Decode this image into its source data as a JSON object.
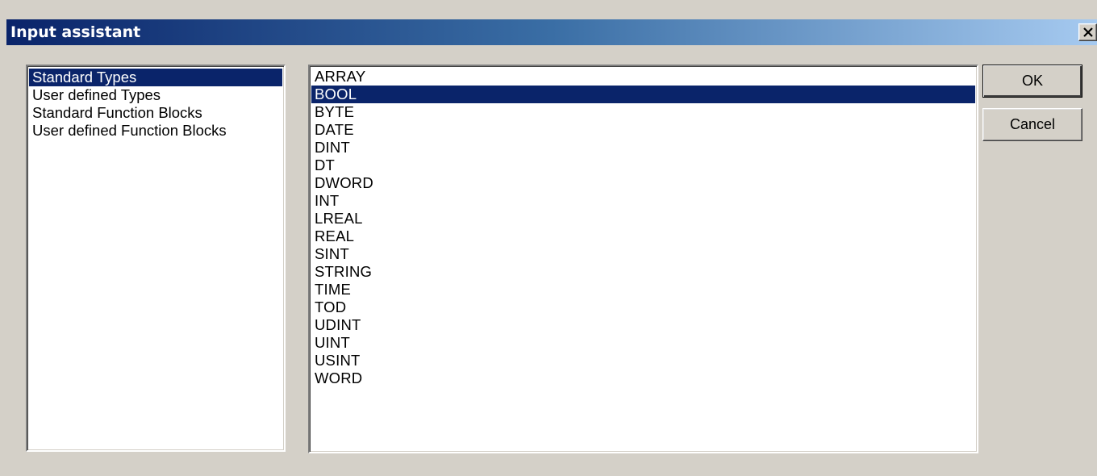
{
  "window": {
    "title": "Input assistant",
    "titlebar_colors": [
      "#0a246a",
      "#3a6ea5",
      "#a6caf0"
    ],
    "close_icon": "close-icon"
  },
  "categories": {
    "items": [
      {
        "label": "Standard Types",
        "selected": true
      },
      {
        "label": "User defined Types",
        "selected": false
      },
      {
        "label": "Standard Function Blocks",
        "selected": false
      },
      {
        "label": "User defined Function Blocks",
        "selected": false
      }
    ]
  },
  "types": {
    "items": [
      {
        "label": "ARRAY",
        "selected": false
      },
      {
        "label": "BOOL",
        "selected": true
      },
      {
        "label": "BYTE",
        "selected": false
      },
      {
        "label": "DATE",
        "selected": false
      },
      {
        "label": "DINT",
        "selected": false
      },
      {
        "label": "DT",
        "selected": false
      },
      {
        "label": "DWORD",
        "selected": false
      },
      {
        "label": "INT",
        "selected": false
      },
      {
        "label": "LREAL",
        "selected": false
      },
      {
        "label": "REAL",
        "selected": false
      },
      {
        "label": "SINT",
        "selected": false
      },
      {
        "label": "STRING",
        "selected": false
      },
      {
        "label": "TIME",
        "selected": false
      },
      {
        "label": "TOD",
        "selected": false
      },
      {
        "label": "UDINT",
        "selected": false
      },
      {
        "label": "UINT",
        "selected": false
      },
      {
        "label": "USINT",
        "selected": false
      },
      {
        "label": "WORD",
        "selected": false
      }
    ]
  },
  "buttons": {
    "ok_label": "OK",
    "cancel_label": "Cancel"
  },
  "colors": {
    "selection": "#0a246a",
    "face": "#d4d0c8"
  }
}
